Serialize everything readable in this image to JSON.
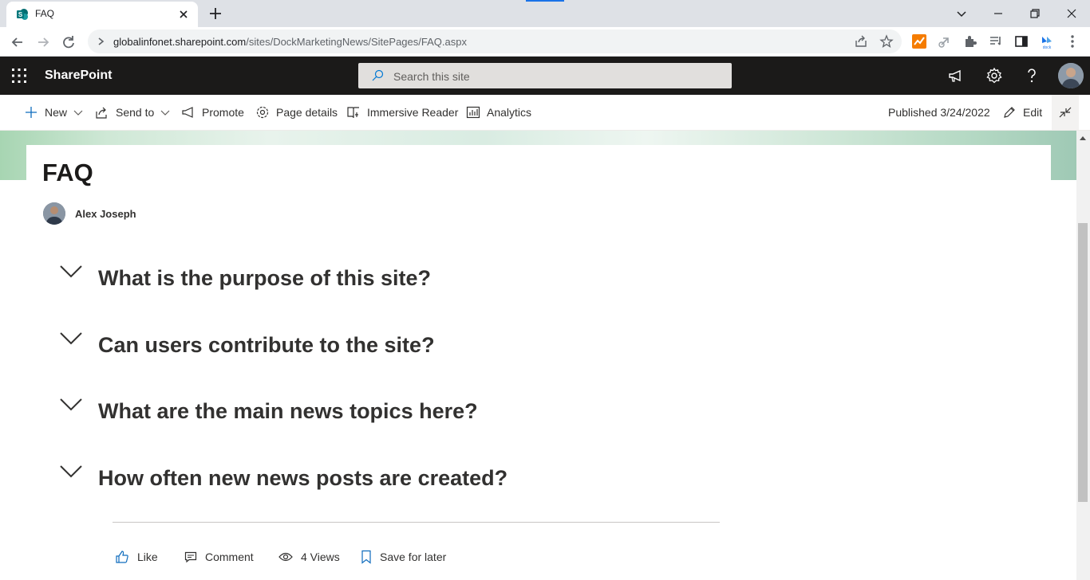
{
  "browser": {
    "tab_title": "FAQ",
    "url_host": "globalinfonet.sharepoint.com",
    "url_path": "/sites/DockMarketingNews/SitePages/FAQ.aspx"
  },
  "suitebar": {
    "brand": "SharePoint",
    "search_placeholder": "Search this site"
  },
  "commandbar": {
    "new": "New",
    "send_to": "Send to",
    "promote": "Promote",
    "page_details": "Page details",
    "immersive_reader": "Immersive Reader",
    "analytics": "Analytics",
    "published": "Published 3/24/2022",
    "edit": "Edit"
  },
  "page": {
    "title": "FAQ",
    "author": "Alex Joseph",
    "faqs": [
      {
        "question": "What is the purpose of this site?"
      },
      {
        "question": "Can users contribute to the site?"
      },
      {
        "question": "What are the main news topics here?"
      },
      {
        "question": "How often new news posts are created?"
      }
    ]
  },
  "social": {
    "like": "Like",
    "comment": "Comment",
    "views": "4 Views",
    "save": "Save for later"
  },
  "colors": {
    "suitebar_bg": "#1b1a19",
    "accent": "#1a73e8",
    "text": "#323130"
  }
}
